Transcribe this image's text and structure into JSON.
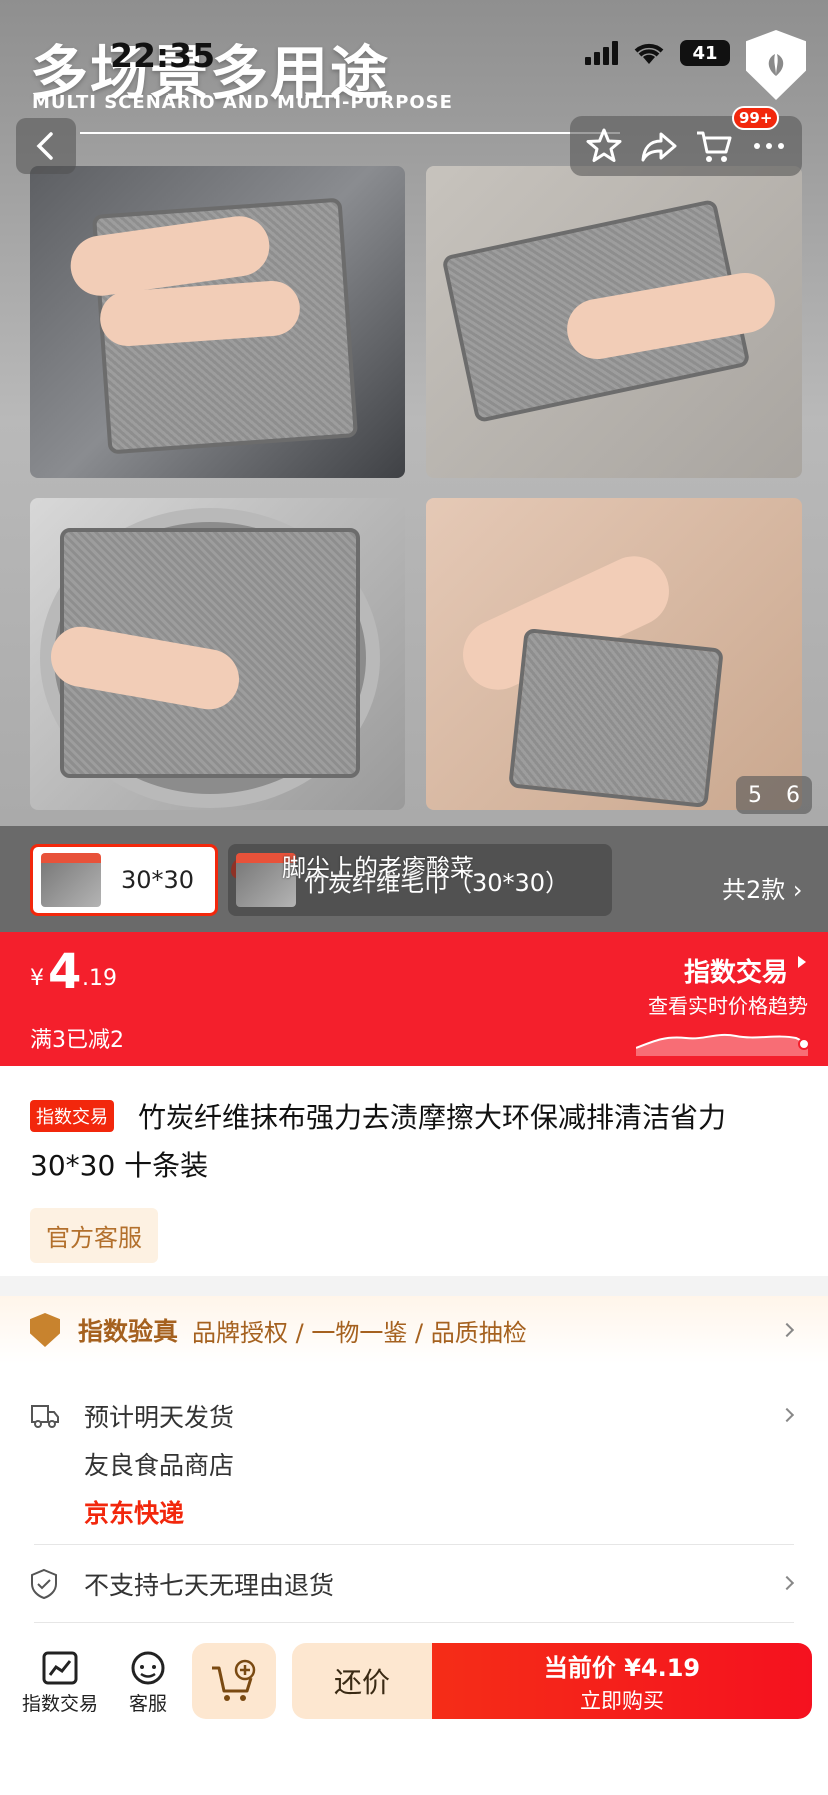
{
  "status_bar": {
    "time": "22:35",
    "battery": "41"
  },
  "hero": {
    "title": "多场景多用途",
    "subtitle": "MULTI SCENARIO AND MULTI-PURPOSE",
    "cart_badge": "99+",
    "page_indicator": {
      "current": "5",
      "total": "6"
    }
  },
  "variants": {
    "items": [
      {
        "label": "30*30",
        "selected": true
      },
      {
        "label": "竹炭纤维毛巾（30*30）",
        "selected": false
      }
    ],
    "total": "共2款",
    "danmaku": "脚尖上的老瘆酸菜"
  },
  "price": {
    "currency": "¥",
    "integer": "4",
    "decimal": ".19",
    "promo": "满3已减2",
    "index_title": "指数交易",
    "index_sub": "查看实时价格趋势"
  },
  "product": {
    "tag": "指数交易",
    "title": "竹炭纤维抹布强力去渍摩擦大环保减排清洁省力30*30 十条装",
    "service": "官方客服"
  },
  "verify": {
    "title": "指数验真",
    "items": "品牌授权 / 一物一鉴 / 品质抽检"
  },
  "shipping": {
    "eta": "预计明天发货",
    "shop": "友良食品商店",
    "courier": "京东快递",
    "return_policy": "不支持七天无理由退货"
  },
  "bottom": {
    "index_label": "指数交易",
    "service_label": "客服",
    "bargain": "还价",
    "buy_price": "当前价 ¥4.19",
    "buy_action": "立即购买"
  },
  "colors": {
    "accent": "#f2270c",
    "gold": "#a5611f"
  }
}
